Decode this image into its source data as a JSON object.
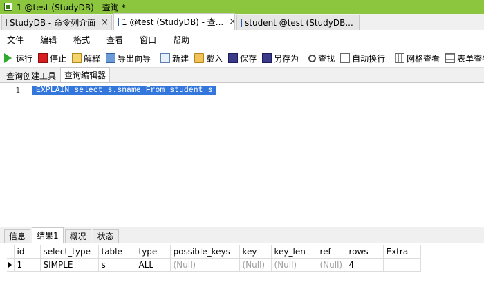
{
  "window": {
    "title": "1 @test (StudyDB) - 查询 *"
  },
  "doc_tabs": [
    {
      "label": "StudyDB - 命令列介面",
      "icon": "console-icon"
    },
    {
      "label": "1 @test (StudyDB) - 查...",
      "icon": "query-icon"
    },
    {
      "label": "student @test (StudyDB...",
      "icon": "table-icon"
    }
  ],
  "close_glyph": "×",
  "menu": [
    "文件",
    "编辑",
    "格式",
    "查看",
    "窗口",
    "帮助"
  ],
  "toolbar": {
    "run": "运行",
    "stop": "停止",
    "explain": "解释",
    "export": "导出向导",
    "new": "新建",
    "load": "载入",
    "save": "保存",
    "save_as": "另存为",
    "find": "查找",
    "word_wrap": "自动换行",
    "grid_view": "网格查看",
    "form_view": "表单查看"
  },
  "sub_tabs": [
    "查询创建工具",
    "查询编辑器"
  ],
  "editor": {
    "line_number": "1",
    "code": "EXPLAIN select s.sname From student s"
  },
  "result_tabs": [
    "信息",
    "结果1",
    "概况",
    "状态"
  ],
  "result_grid": {
    "columns": [
      "id",
      "select_type",
      "table",
      "type",
      "possible_keys",
      "key",
      "key_len",
      "ref",
      "rows",
      "Extra"
    ],
    "rows": [
      [
        "1",
        "SIMPLE",
        "s",
        "ALL",
        "(Null)",
        "(Null)",
        "(Null)",
        "(Null)",
        "4",
        ""
      ]
    ]
  },
  "colors": {
    "title_bar": "#8cc63f",
    "selection": "#3377dd",
    "null_text": "#a0a0a0"
  }
}
